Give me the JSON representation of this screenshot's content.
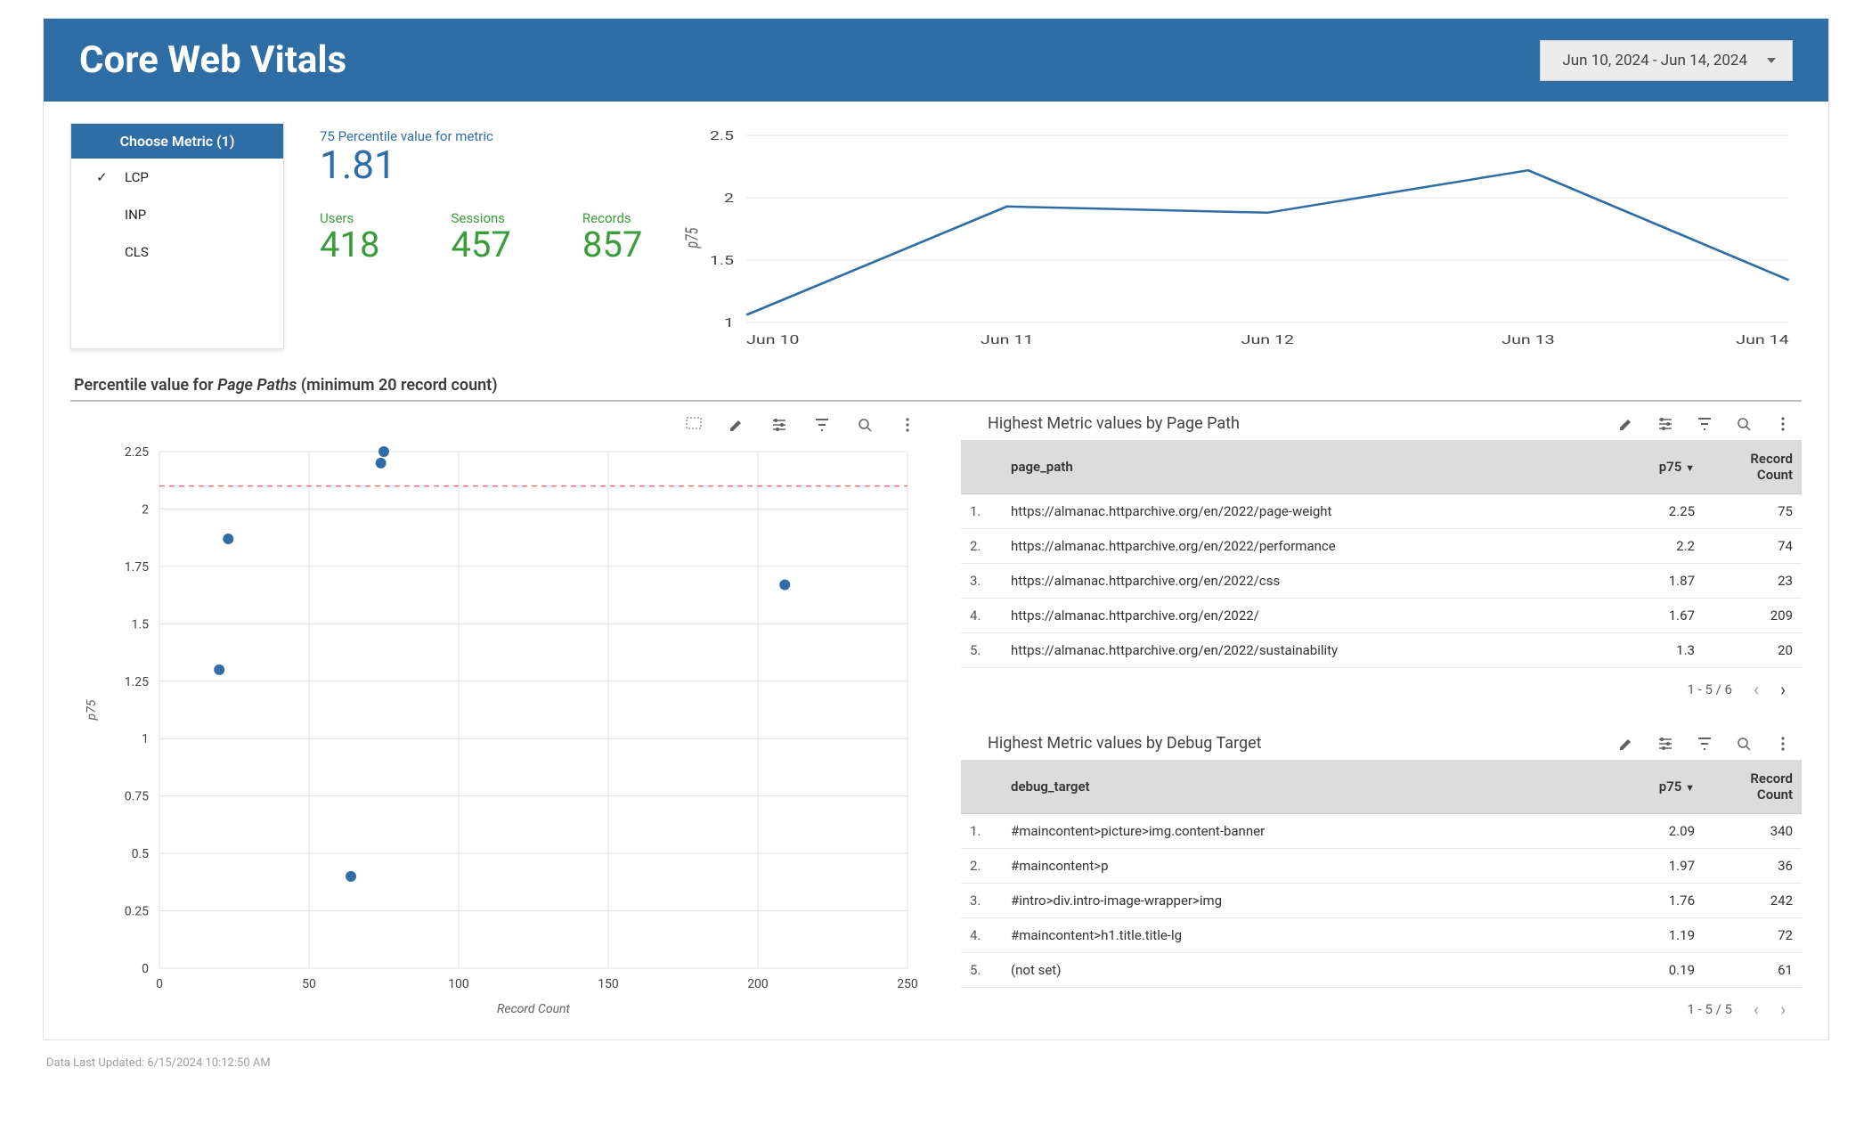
{
  "header": {
    "title": "Core Web Vitals",
    "date_range": "Jun 10, 2024 - Jun 14, 2024"
  },
  "metric_selector": {
    "title": "Choose Metric (1)",
    "options": [
      {
        "label": "LCP",
        "selected": true
      },
      {
        "label": "INP",
        "selected": false
      },
      {
        "label": "CLS",
        "selected": false
      }
    ]
  },
  "kpi_main": {
    "label": "75 Percentile value for metric",
    "value": "1.81"
  },
  "kpis": [
    {
      "label": "Users",
      "value": "418"
    },
    {
      "label": "Sessions",
      "value": "457"
    },
    {
      "label": "Records",
      "value": "857"
    }
  ],
  "section_title": {
    "prefix": "Percentile value for ",
    "italic": "Page Paths",
    "suffix": " (minimum 20 record count)"
  },
  "chart_data": [
    {
      "id": "p75_trend",
      "type": "line",
      "ylabel": "p75",
      "ylim": [
        1,
        2.5
      ],
      "yticks": [
        1,
        1.5,
        2,
        2.5
      ],
      "categories": [
        "Jun 10",
        "Jun 11",
        "Jun 12",
        "Jun 13",
        "Jun 14"
      ],
      "values": [
        1.06,
        1.93,
        1.88,
        2.22,
        1.34
      ]
    },
    {
      "id": "page_path_scatter",
      "type": "scatter",
      "xlabel": "Record Count",
      "ylabel": "p75",
      "xlim": [
        0,
        250
      ],
      "xticks": [
        0,
        50,
        100,
        150,
        200,
        250
      ],
      "ylim": [
        0,
        2.25
      ],
      "yticks": [
        0,
        0.25,
        0.5,
        0.75,
        1,
        1.25,
        1.5,
        1.75,
        2,
        2.25
      ],
      "reference_line_y": 2.1,
      "points": [
        {
          "x": 75,
          "y": 2.25
        },
        {
          "x": 74,
          "y": 2.2
        },
        {
          "x": 23,
          "y": 1.87
        },
        {
          "x": 209,
          "y": 1.67
        },
        {
          "x": 20,
          "y": 1.3
        },
        {
          "x": 64,
          "y": 0.4
        }
      ]
    }
  ],
  "tables": {
    "page_path": {
      "title": "Highest Metric values by Page Path",
      "columns": {
        "c1": "page_path",
        "c2": "p75",
        "c3": "Record Count"
      },
      "sort_indicator": "▼",
      "rows": [
        {
          "i": "1.",
          "path": "https://almanac.httparchive.org/en/2022/page-weight",
          "p75": "2.25",
          "rc": "75"
        },
        {
          "i": "2.",
          "path": "https://almanac.httparchive.org/en/2022/performance",
          "p75": "2.2",
          "rc": "74"
        },
        {
          "i": "3.",
          "path": "https://almanac.httparchive.org/en/2022/css",
          "p75": "1.87",
          "rc": "23"
        },
        {
          "i": "4.",
          "path": "https://almanac.httparchive.org/en/2022/",
          "p75": "1.67",
          "rc": "209"
        },
        {
          "i": "5.",
          "path": "https://almanac.httparchive.org/en/2022/sustainability",
          "p75": "1.3",
          "rc": "20"
        }
      ],
      "pager": "1 - 5 / 6"
    },
    "debug_target": {
      "title": "Highest Metric values by Debug Target",
      "columns": {
        "c1": "debug_target",
        "c2": "p75",
        "c3": "Record Count"
      },
      "sort_indicator": "▼",
      "rows": [
        {
          "i": "1.",
          "path": "#maincontent>picture>img.content-banner",
          "p75": "2.09",
          "rc": "340"
        },
        {
          "i": "2.",
          "path": "#maincontent>p",
          "p75": "1.97",
          "rc": "36"
        },
        {
          "i": "3.",
          "path": "#intro>div.intro-image-wrapper>img",
          "p75": "1.76",
          "rc": "242"
        },
        {
          "i": "4.",
          "path": "#maincontent>h1.title.title-lg",
          "p75": "1.19",
          "rc": "72"
        },
        {
          "i": "5.",
          "path": "(not set)",
          "p75": "0.19",
          "rc": "61"
        }
      ],
      "pager": "1 - 5 / 5"
    }
  },
  "footer": {
    "updated": "Data Last Updated: 6/15/2024 10:12:50 AM"
  }
}
